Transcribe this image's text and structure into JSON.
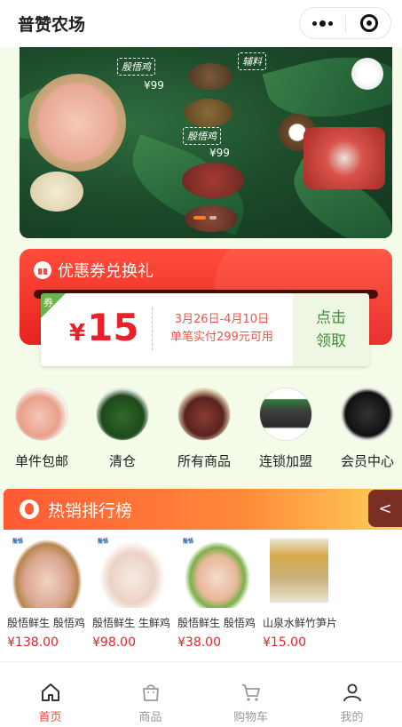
{
  "header": {
    "title": "普赞农场"
  },
  "banner": {
    "tags": [
      "殷悟鸡",
      "辅料",
      "殷悟鸡"
    ],
    "prices": [
      "¥99",
      "¥99"
    ]
  },
  "coupon": {
    "section_title": "优惠券兑换礼",
    "corner_label": "券",
    "currency": "¥",
    "amount": "15",
    "date_range": "3月26日-4月10日",
    "condition": "单笔实付299元可用",
    "redeem_line1": "点击",
    "redeem_line2": "领取"
  },
  "categories": [
    {
      "label": "单件包邮"
    },
    {
      "label": "清仓"
    },
    {
      "label": "所有商品"
    },
    {
      "label": "连锁加盟"
    },
    {
      "label": "会员中心"
    }
  ],
  "hot": {
    "title": "热销排行榜",
    "collapse": "<"
  },
  "products": [
    {
      "name": "殷悟鲜生 殷悟鸡",
      "price": "¥138.00"
    },
    {
      "name": "殷悟鲜生 生鲜鸡",
      "price": "¥98.00"
    },
    {
      "name": "殷悟鲜生 殷悟鸡",
      "price": "¥38.00"
    },
    {
      "name": "山泉水鲜竹笋片",
      "price": "¥15.00"
    }
  ],
  "tabbar": [
    {
      "label": "首页",
      "active": true
    },
    {
      "label": "商品"
    },
    {
      "label": "购物车"
    },
    {
      "label": "我的"
    }
  ],
  "colors": {
    "accent": "#e8222a",
    "green": "#3f8f33",
    "orange": "#ff7b2a"
  }
}
